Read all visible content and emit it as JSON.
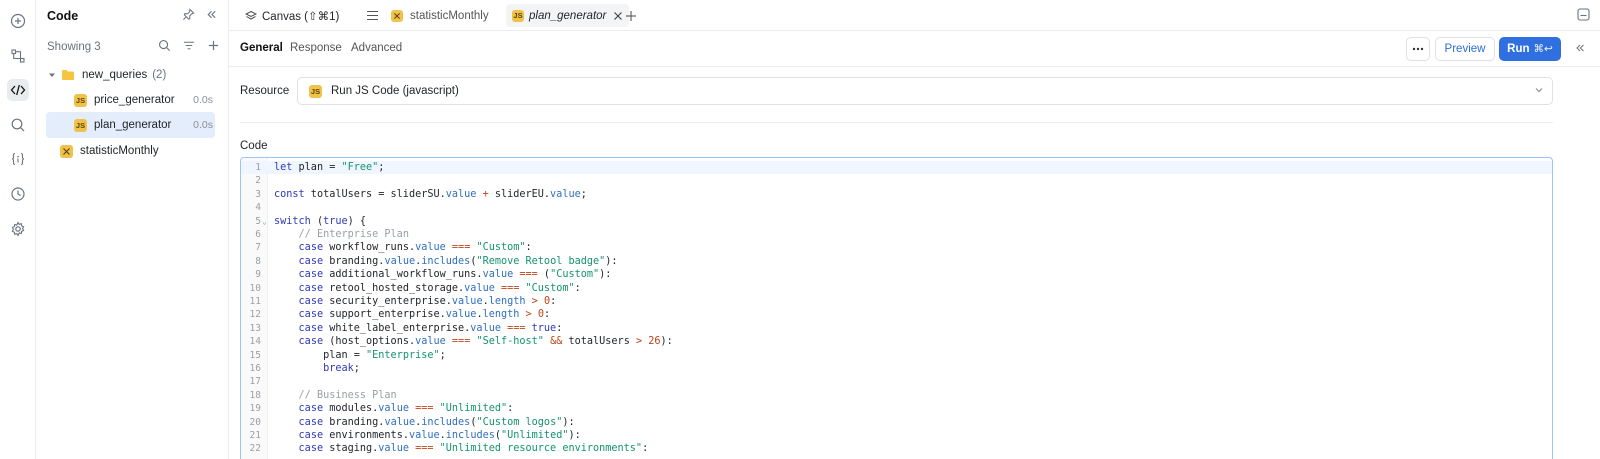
{
  "rail": {
    "items": [
      {
        "icon": "add-icon"
      },
      {
        "icon": "workflow-icon"
      },
      {
        "icon": "code-icon",
        "active": true
      },
      {
        "icon": "search-icon"
      },
      {
        "icon": "state-icon"
      },
      {
        "icon": "history-icon"
      },
      {
        "icon": "settings-icon"
      }
    ]
  },
  "panel": {
    "title": "Code",
    "showing": "Showing 3",
    "folder": {
      "name": "new_queries",
      "count": "(2)"
    },
    "queries": [
      {
        "name": "price_generator",
        "duration": "0.0s",
        "badge": "JS"
      },
      {
        "name": "plan_generator",
        "duration": "0.0s",
        "badge": "JS",
        "selected": true
      }
    ],
    "workflow": {
      "name": "statisticMonthly"
    }
  },
  "tabs": {
    "canvas": "Canvas (⇧⌘1)",
    "doc1": "statisticMonthly",
    "doc2": "plan_generator",
    "doc2_badge": "JS"
  },
  "subtabs": {
    "general": "General",
    "response": "Response",
    "advanced": "Advanced"
  },
  "actions": {
    "preview": "Preview",
    "run": "Run",
    "run_shortcut": "⌘↩"
  },
  "resource": {
    "label": "Resource",
    "value": "Run JS Code (javascript)",
    "badge": "JS"
  },
  "code": {
    "label": "Code",
    "lines": [
      "1",
      "2",
      "3",
      "4",
      "5",
      "6",
      "7",
      "8",
      "9",
      "10",
      "11",
      "12",
      "13",
      "14",
      "15",
      "16",
      "17",
      "18",
      "19",
      "20",
      "21",
      "22"
    ]
  },
  "colors": {
    "accent": "#2f6fe0",
    "selected_row": "#e3edfb",
    "js_badge": "#f0c24b"
  }
}
